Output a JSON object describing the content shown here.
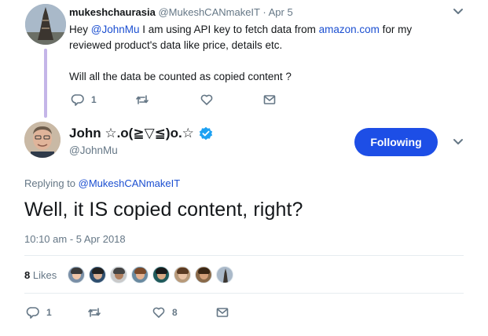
{
  "parent_tweet": {
    "display_name": "mukeshchaurasia",
    "handle": "@MukeshCANmakeIT",
    "separator": "·",
    "date": "Apr 5",
    "body": {
      "greeting": "Hey ",
      "mention": "@JohnMu",
      "text_before_link": " I am using API key to fetch data from ",
      "link": "amazon.com",
      "text_after_link": " for my",
      "line2": "reviewed product's data like price, details etc.",
      "line3": "Will all the data be counted as copied content ?"
    },
    "actions": {
      "reply_count": "1",
      "retweet_count": "",
      "like_count": ""
    }
  },
  "main_tweet": {
    "display_name": "John ☆.o(≧▽≦)o.☆",
    "handle": "@JohnMu",
    "follow_label": "Following",
    "replying_prefix": "Replying to ",
    "replying_to": "@MukeshCANmakeIT",
    "text": "Well, it IS copied content, right?",
    "timestamp": "10:10 am - 5 Apr 2018",
    "likes_number": "8",
    "likes_word": " Likes",
    "actions": {
      "reply_count": "1",
      "retweet_count": "",
      "like_count": "8"
    }
  },
  "icons": {
    "reply": "reply-icon",
    "retweet": "retweet-icon",
    "like": "heart-icon",
    "dm": "envelope-icon",
    "verified": "verified-badge-icon",
    "more": "chevron-down-icon"
  },
  "colors": {
    "follow_button": "#1d4ee6",
    "link": "#1b4fd1",
    "verified": "#1da1f2",
    "muted_text": "#657786",
    "thread_line": "#c4b5e8"
  }
}
